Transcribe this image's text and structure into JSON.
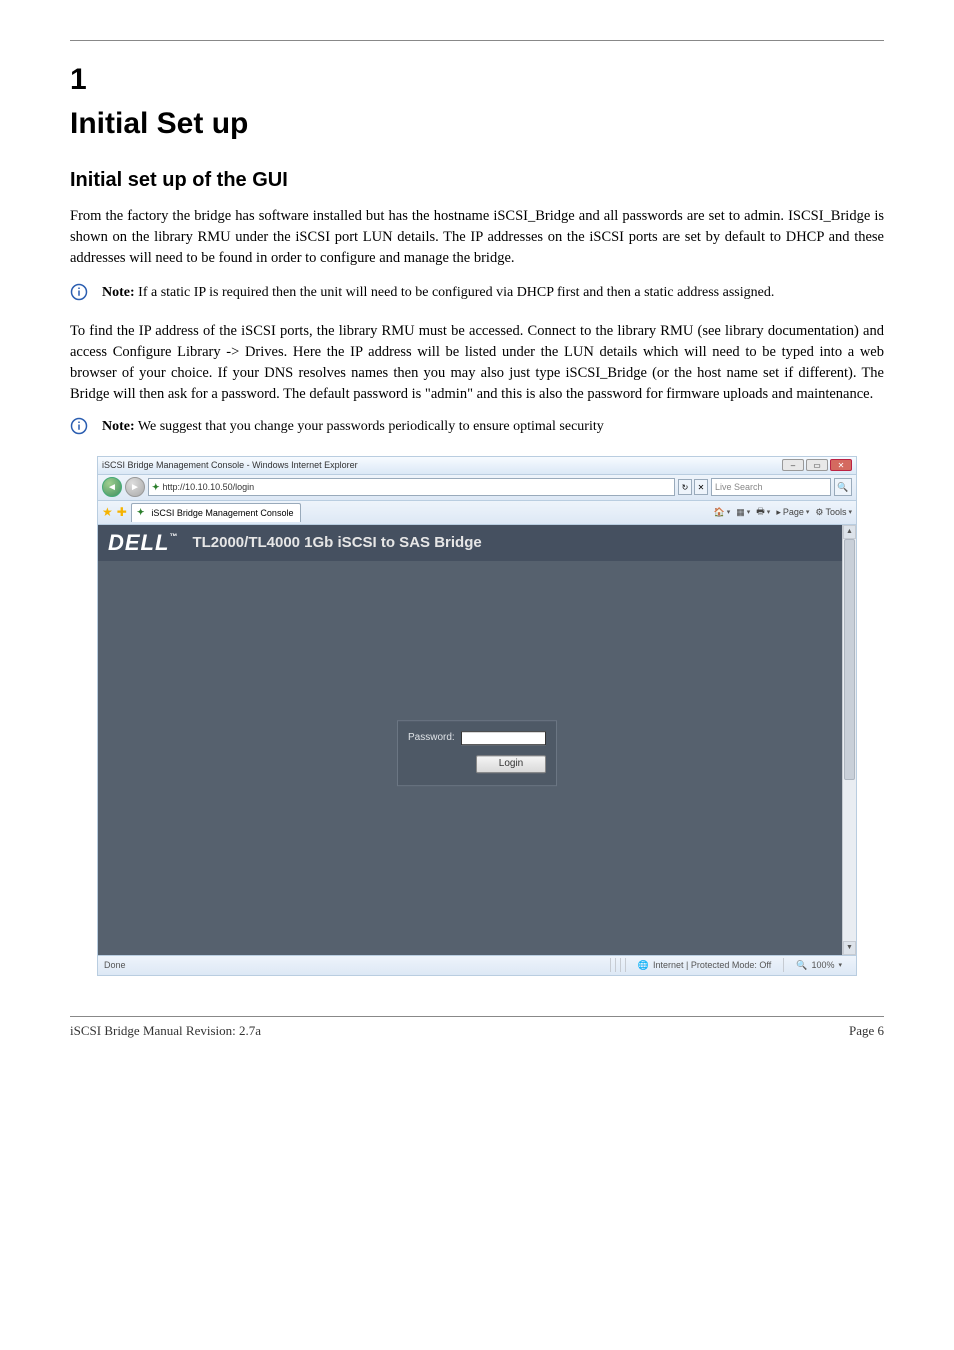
{
  "chapter": {
    "num": "1",
    "title": "Initial Set up"
  },
  "section": {
    "title": "Initial set up of the GUI"
  },
  "paragraphs": {
    "p1": "From the factory the bridge has software installed but has the hostname iSCSI_Bridge and all passwords are set to admin. ISCSI_Bridge is shown on the library RMU under the iSCSI port LUN details. The IP addresses on the iSCSI ports are set by default to DHCP and these addresses will need to be found in order to configure and manage the bridge.",
    "p2": "To find the IP address of the iSCSI ports, the library RMU must be accessed. Connect to the library RMU (see library documentation) and access Configure Library -> Drives. Here the IP address will be listed under the LUN details which will need to be typed into a web browser of your choice. If your DNS resolves names then you may also just type iSCSI_Bridge (or the host name set if different). The Bridge will then ask for a password. The default password is \"admin\" and this is also the password for firmware uploads and maintenance."
  },
  "notes": {
    "n1_label": "Note:",
    "n1_text": " If a static IP is required then the unit will need to be configured via DHCP first and then a static address assigned.",
    "n2_label": "Note:",
    "n2_text": " We suggest that you change your passwords periodically to ensure optimal security"
  },
  "browser": {
    "window_title": "iSCSI Bridge Management Console - Windows Internet Explorer",
    "url": "http://10.10.10.50/login",
    "tab_title": "iSCSI Bridge Management Console",
    "search_placeholder": "Live Search",
    "toolbar": {
      "page": "Page",
      "tools": "Tools"
    },
    "status_left": "Done",
    "status_zone": "Internet | Protected Mode: Off",
    "status_zoom": "100%"
  },
  "bridge_page": {
    "brand": "DELL",
    "tm": "™",
    "title": "TL2000/TL4000 1Gb iSCSI to SAS Bridge",
    "password_label": "Password:",
    "login_button": "Login"
  },
  "footer": {
    "left": "iSCSI Bridge Manual Revision: 2.7a",
    "right": "Page 6"
  }
}
